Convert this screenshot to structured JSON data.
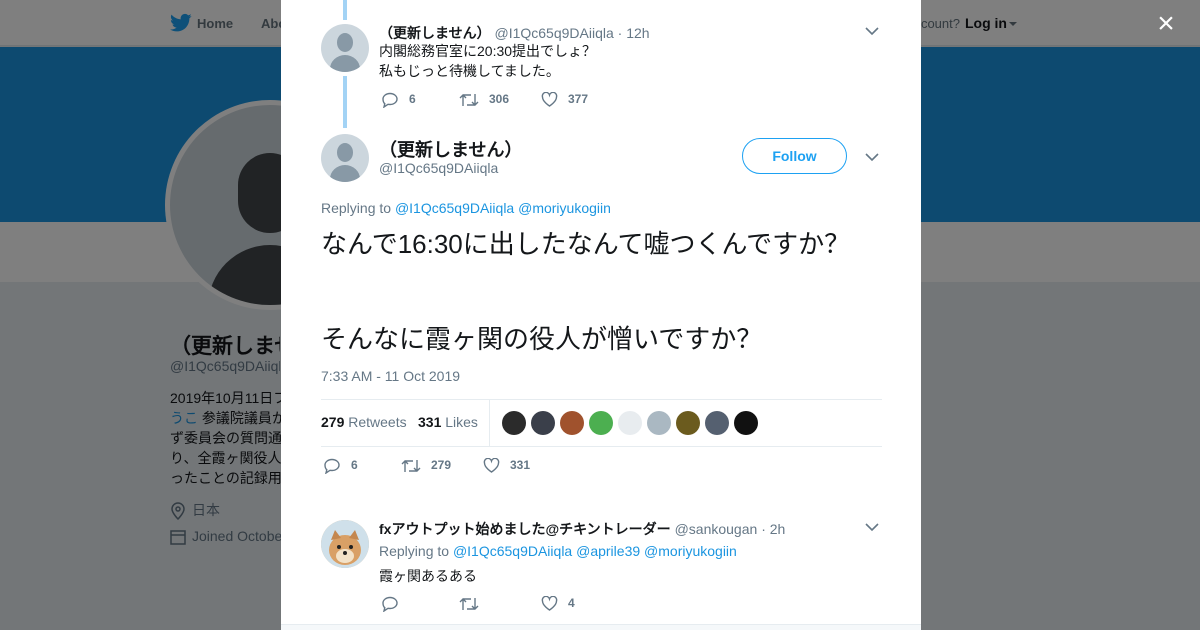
{
  "topnav": {
    "home_label": "Home",
    "about_label": "Abo",
    "have_account": "ccount?",
    "login_label": "Log in"
  },
  "profile": {
    "name": "（更新しませ",
    "handle": "@I1Qc65q9DAiiql",
    "bio_lines": [
      "2019年10月11日フ",
      "うこ 参議院議員か",
      "ず委員会の質問通",
      "り、全霞ヶ関役人",
      "ったことの記録用"
    ],
    "bio_link": "うこ",
    "location": "日本",
    "joined": "Joined Octobe"
  },
  "modal": {
    "close_label": "×",
    "prev_tweet": {
      "name": "（更新しません）",
      "handle": "@I1Qc65q9DAiiqla",
      "time": "· 12h",
      "text_line1": "内閣総務官室に20:30提出でしょ？",
      "text_line2": "私もじっと待機してました。",
      "replies": "6",
      "retweets": "306",
      "likes": "377"
    },
    "main_tweet": {
      "name": "（更新しません）",
      "handle": "@I1Qc65q9DAiiqla",
      "follow_label": "Follow",
      "replying_prefix": "Replying to",
      "mention1": "@I1Qc65q9DAiiqla",
      "mention2": "@moriyukogiin",
      "text_para1": "なんで16:30に出したなんて嘘つくんですか？",
      "text_para2": "そんなに霞ヶ関の役人が憎いですか？",
      "timestamp": "7:33 AM - 11 Oct 2019",
      "retweets_count": "279",
      "retweets_label": "Retweets",
      "likes_count": "331",
      "likes_label": "Likes",
      "replies": "6",
      "retweets": "279",
      "likes": "331",
      "liker_colors": [
        "#2b2b2b",
        "#3a3f4a",
        "#a0522d",
        "#4caf50",
        "#e8ecef",
        "#aab8c2",
        "#6b5b1e",
        "#556070",
        "#111111"
      ]
    },
    "reply_tweet": {
      "name": "fxアウトプット始めました@チキントレーダー",
      "handle": "@sankougan",
      "time": "· 2h",
      "replying_prefix": "Replying to",
      "mention1": "@I1Qc65q9DAiiqla",
      "mention2": "@aprile39",
      "mention3": "@moriyukogiin",
      "text": "霞ヶ関あるある",
      "replies": "",
      "retweets": "",
      "likes": "4"
    }
  },
  "colors": {
    "twitter_blue": "#1da1f2",
    "banner_blue": "#1b95e0",
    "thread_line": "#a3d3f5"
  }
}
